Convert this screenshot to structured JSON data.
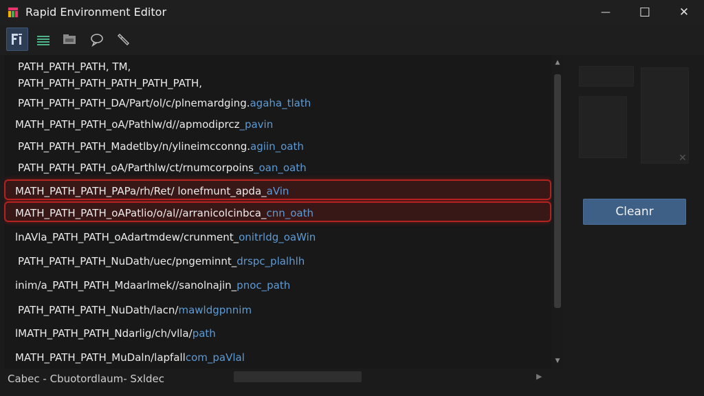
{
  "window": {
    "title": "Rapid Environment Editor",
    "minimize_glyph": "—",
    "maximize_glyph": "☐",
    "close_glyph": "✕"
  },
  "toolbar": {
    "items": [
      {
        "name": "variables-view-button",
        "icon": "variables-icon",
        "active": true
      },
      {
        "name": "list-view-button",
        "icon": "list-icon",
        "active": false
      },
      {
        "name": "folder-view-button",
        "icon": "folder-icon",
        "active": false
      },
      {
        "name": "comment-button",
        "icon": "speech-bubble-icon",
        "active": false
      },
      {
        "name": "settings-button",
        "icon": "wrench-icon",
        "active": false
      }
    ]
  },
  "path_list": {
    "rows": [
      {
        "p1": "PATH_PATH_PATH, TM,",
        "p2": "",
        "selected": false
      },
      {
        "p1": "PATH_PATH_PATH_PATH_PATH_PATH,",
        "p2": "",
        "selected": false
      },
      {
        "p1": "PATH_PATH_PATH_DA/Part/ol/c/plnemardging.",
        "p2": "agaha_tlath",
        "selected": false
      },
      {
        "p1": "MATH_PATH_PATH_oA/Pathlw/d//apmodiprcz",
        "p2": "_pavin",
        "selected": false
      },
      {
        "p1": "PATH_PATH_PATH_Madetlby/n/ylineimcconng.",
        "p2": "agiin_oath",
        "selected": false
      },
      {
        "p1": "PATH_PATH_PATH_oA/Parthlw/ct/rnumcorpoins",
        "p2": "_oan_oath",
        "selected": false
      },
      {
        "p1": "MATH_PATH_PATH_PAPa/rh/Ret/ lonefmunt_apda_",
        "p2": "aVin",
        "selected": true
      },
      {
        "p1": "MATH_PATH_PATH_oAPatlio/o/al//arranicolcinbca_",
        "p2": "cnn_oath",
        "selected": true
      },
      {
        "p1": "lnAVla_PATH_PATH_oAdartmdew/crunment_",
        "p2": "onitrldg_oaWin",
        "selected": false
      },
      {
        "p1": "PATH_PATH_PATH_NuDath/uec/pngeminnt_",
        "p2": "drspc_plalhlh",
        "selected": false
      },
      {
        "p1": "inim/a_PATH_PATH_Mdaarlmek//sanolnajin_",
        "p2": "pnoc_path",
        "selected": false
      },
      {
        "p1": "PATH_PATH_PATH_NuDath/lacn/",
        "p2": "mawldgpnnim",
        "selected": false
      },
      {
        "p1": "lMATH_PATH_PATH_Ndarlig/ch/vlla/",
        "p2": "path",
        "selected": false
      },
      {
        "p1": "MATH_PATH_PATH_MuDaln/lapfall",
        "p2": "com_paVlal",
        "selected": false
      }
    ]
  },
  "actions": {
    "clean_label": "Cleanr"
  },
  "status": {
    "text": "Cabec - Cbuotordlaum- Sxldec"
  },
  "colors": {
    "path_text": "#ececec",
    "path_suffix": "#5d9bd6",
    "selection_border": "#b3231f",
    "button_bg": "#3e5f86"
  }
}
